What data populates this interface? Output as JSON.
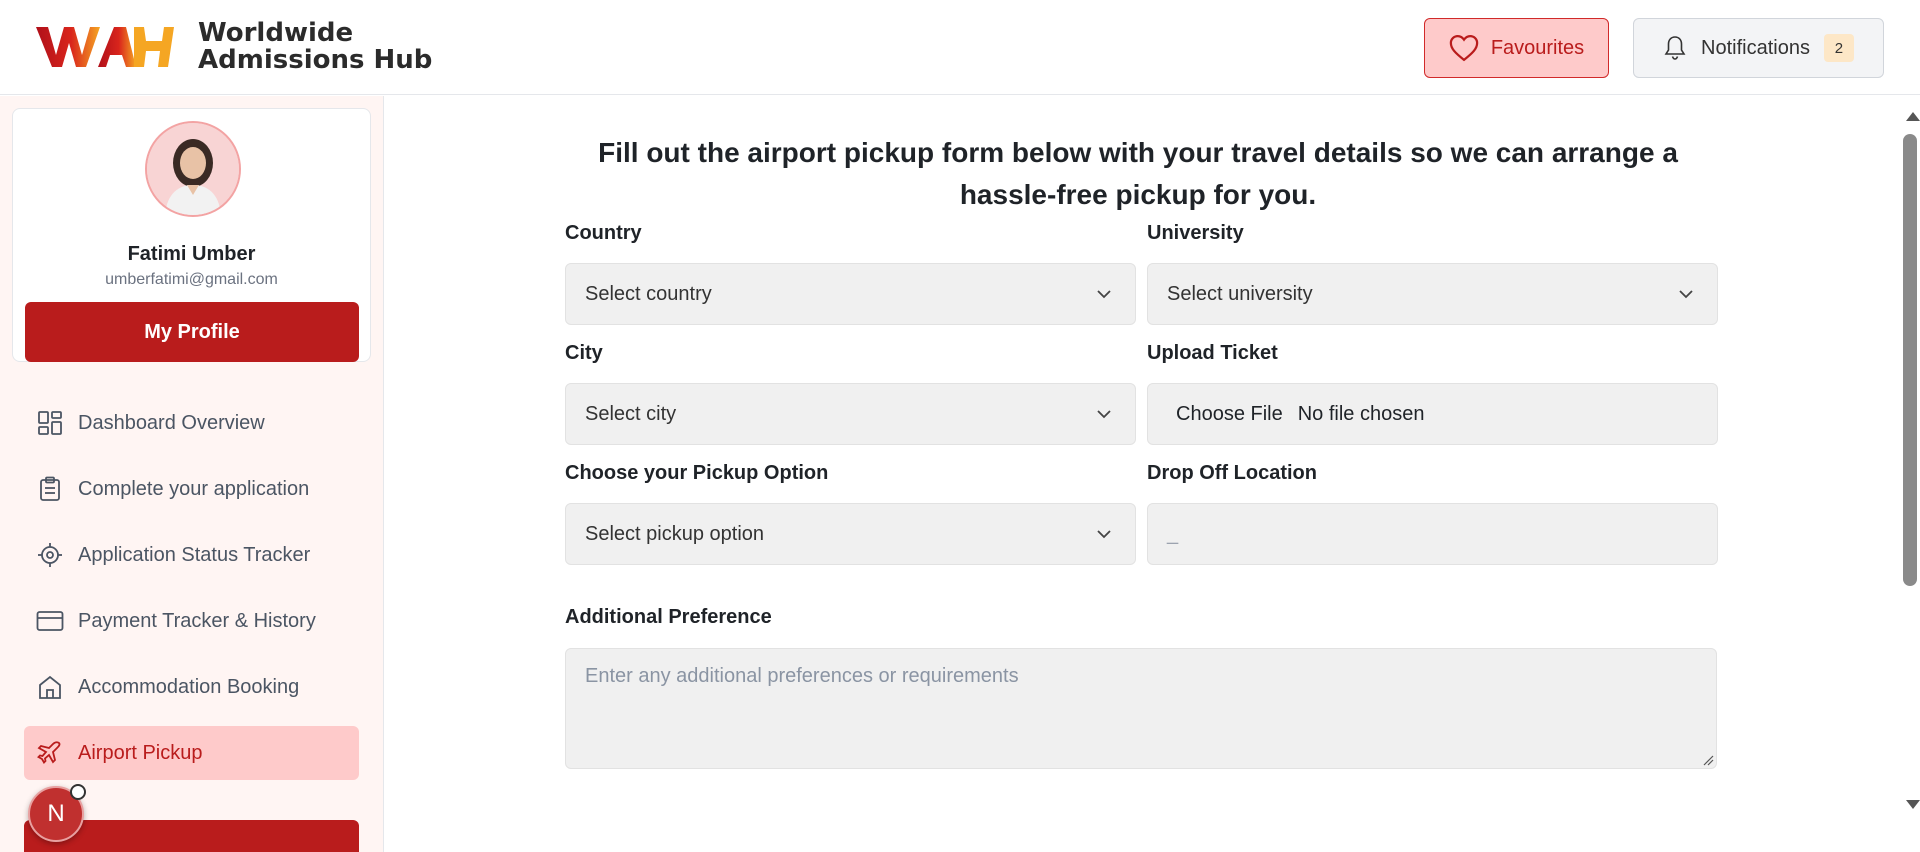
{
  "header": {
    "logo_text_line1": "Worldwide",
    "logo_text_line2": "Admissions Hub",
    "favourites_label": "Favourites",
    "notifications_label": "Notifications",
    "notifications_count": "2"
  },
  "profile": {
    "name": "Fatimi Umber",
    "email": "umberfatimi@gmail.com",
    "button_label": "My Profile"
  },
  "sidebar": {
    "items": [
      {
        "label": "Dashboard Overview",
        "icon": "dashboard-icon"
      },
      {
        "label": "Complete your application",
        "icon": "clipboard-icon"
      },
      {
        "label": "Application Status Tracker",
        "icon": "target-icon"
      },
      {
        "label": "Payment Tracker & History",
        "icon": "card-icon"
      },
      {
        "label": "Accommodation Booking",
        "icon": "home-icon"
      },
      {
        "label": "Airport Pickup",
        "icon": "plane-icon",
        "active": true
      }
    ],
    "floating_badge": "N"
  },
  "form": {
    "title": "Fill out the airport pickup form below with your travel details so we can arrange a hassle-free pickup for you.",
    "country_label": "Country",
    "country_placeholder": "Select country",
    "university_label": "University",
    "university_placeholder": "Select university",
    "city_label": "City",
    "city_placeholder": "Select city",
    "ticket_label": "Upload Ticket",
    "ticket_button": "Choose File",
    "ticket_status": "No file chosen",
    "pickup_label": "Choose your Pickup Option",
    "pickup_placeholder": "Select pickup option",
    "dropoff_label": "Drop Off Location",
    "dropoff_value": "_",
    "additional_label": "Additional Preference",
    "additional_placeholder": "Enter any additional preferences or requirements"
  },
  "colors": {
    "brand_red": "#b91c1c",
    "active_bg": "#fecaca"
  }
}
